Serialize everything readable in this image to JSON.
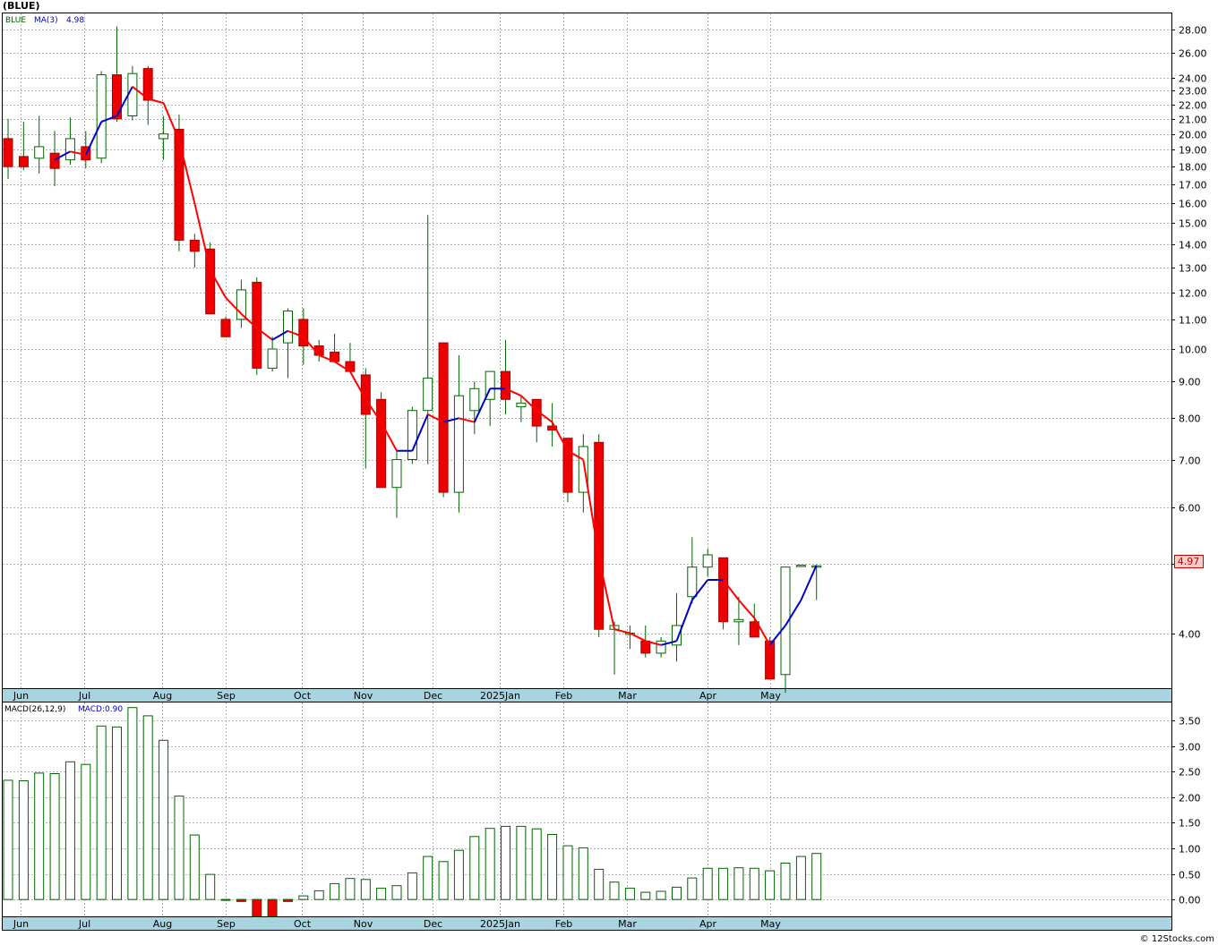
{
  "header": {
    "ticker_title": "(BLUE)",
    "legend_symbol": "BLUE",
    "legend_ma": "MA(3)",
    "legend_ma_value": "4.98",
    "macd_label": "MACD(26,12,9)",
    "macd_value": "MACD:0.90",
    "last_price_tag": "4.97",
    "watermark": "© 12Stocks.com"
  },
  "colors": {
    "up_candle": "#ffffff",
    "down_candle": "#ee0000",
    "candle_outline": "#006400",
    "ma_up": "#0000cc",
    "ma_down": "#ff0000",
    "date_band": "#a8d4e0",
    "grid": "#b4b4b4",
    "price_tag_bg": "#ffcccc"
  },
  "chart_data": [
    {
      "type": "candlestick",
      "scale": "log",
      "ylim": [
        3.35,
        29.5
      ],
      "y_ticks": [
        "4.00",
        "5.00",
        "6.00",
        "7.00",
        "8.00",
        "9.00",
        "10.00",
        "11.00",
        "12.00",
        "13.00",
        "14.00",
        "15.00",
        "16.00",
        "17.00",
        "18.00",
        "19.00",
        "20.00",
        "21.00",
        "22.00",
        "23.00",
        "24.00",
        "26.00",
        "28.00"
      ],
      "x_ticks": [
        {
          "label": "Jun",
          "index": 0.8
        },
        {
          "label": "Jul",
          "index": 4.9
        },
        {
          "label": "Aug",
          "index": 9.9
        },
        {
          "label": "Sep",
          "index": 14.0
        },
        {
          "label": "Oct",
          "index": 18.9
        },
        {
          "label": "Nov",
          "index": 22.8
        },
        {
          "label": "Dec",
          "index": 27.3
        },
        {
          "label": "2025Jan",
          "index": 31.6
        },
        {
          "label": "Feb",
          "index": 35.7
        },
        {
          "label": "Mar",
          "index": 39.8
        },
        {
          "label": "Apr",
          "index": 45.0
        },
        {
          "label": "May",
          "index": 49.0
        }
      ],
      "candles": [
        {
          "o": 19.7,
          "h": 21.0,
          "l": 17.3,
          "c": 18.0
        },
        {
          "o": 18.6,
          "h": 20.8,
          "l": 17.8,
          "c": 18.0
        },
        {
          "o": 18.5,
          "h": 21.2,
          "l": 17.6,
          "c": 19.2
        },
        {
          "o": 18.8,
          "h": 20.2,
          "l": 16.9,
          "c": 17.9
        },
        {
          "o": 18.4,
          "h": 21.1,
          "l": 18.1,
          "c": 19.7
        },
        {
          "o": 19.2,
          "h": 20.2,
          "l": 17.9,
          "c": 18.4
        },
        {
          "o": 18.5,
          "h": 24.5,
          "l": 18.2,
          "c": 24.2
        },
        {
          "o": 24.2,
          "h": 28.3,
          "l": 20.8,
          "c": 21.0
        },
        {
          "o": 21.2,
          "h": 24.9,
          "l": 20.9,
          "c": 24.3
        },
        {
          "o": 24.7,
          "h": 24.9,
          "l": 20.6,
          "c": 22.3
        },
        {
          "o": 19.7,
          "h": 21.2,
          "l": 18.4,
          "c": 20.0
        },
        {
          "o": 20.3,
          "h": 21.3,
          "l": 13.7,
          "c": 14.2
        },
        {
          "o": 14.2,
          "h": 14.5,
          "l": 13.0,
          "c": 13.7
        },
        {
          "o": 13.8,
          "h": 14.1,
          "l": 11.2,
          "c": 11.2
        },
        {
          "o": 11.0,
          "h": 11.1,
          "l": 10.4,
          "c": 10.4
        },
        {
          "o": 11.0,
          "h": 12.5,
          "l": 10.7,
          "c": 12.1
        },
        {
          "o": 12.4,
          "h": 12.6,
          "l": 9.2,
          "c": 9.4
        },
        {
          "o": 9.4,
          "h": 10.4,
          "l": 9.3,
          "c": 10.0
        },
        {
          "o": 10.2,
          "h": 11.4,
          "l": 9.1,
          "c": 11.3
        },
        {
          "o": 11.0,
          "h": 11.4,
          "l": 9.5,
          "c": 10.1
        },
        {
          "o": 10.1,
          "h": 10.3,
          "l": 9.6,
          "c": 9.8
        },
        {
          "o": 9.9,
          "h": 10.5,
          "l": 9.6,
          "c": 9.6
        },
        {
          "o": 9.6,
          "h": 10.2,
          "l": 9.3,
          "c": 9.3
        },
        {
          "o": 9.2,
          "h": 9.4,
          "l": 6.8,
          "c": 8.1
        },
        {
          "o": 8.5,
          "h": 8.7,
          "l": 6.4,
          "c": 6.4
        },
        {
          "o": 6.4,
          "h": 7.2,
          "l": 5.8,
          "c": 7.0
        },
        {
          "o": 7.0,
          "h": 8.3,
          "l": 6.9,
          "c": 8.2
        },
        {
          "o": 8.2,
          "h": 15.4,
          "l": 6.9,
          "c": 9.1
        },
        {
          "o": 10.2,
          "h": 10.2,
          "l": 6.2,
          "c": 6.3
        },
        {
          "o": 6.3,
          "h": 9.8,
          "l": 5.9,
          "c": 8.6
        },
        {
          "o": 8.2,
          "h": 9.0,
          "l": 7.6,
          "c": 8.8
        },
        {
          "o": 8.5,
          "h": 9.3,
          "l": 7.8,
          "c": 9.3
        },
        {
          "o": 9.3,
          "h": 10.3,
          "l": 8.1,
          "c": 8.5
        },
        {
          "o": 8.3,
          "h": 8.6,
          "l": 7.9,
          "c": 8.4
        },
        {
          "o": 8.5,
          "h": 8.5,
          "l": 7.4,
          "c": 7.8
        },
        {
          "o": 7.8,
          "h": 8.4,
          "l": 7.3,
          "c": 7.7
        },
        {
          "o": 7.5,
          "h": 7.5,
          "l": 6.1,
          "c": 6.3
        },
        {
          "o": 6.3,
          "h": 7.6,
          "l": 5.9,
          "c": 7.3
        },
        {
          "o": 7.4,
          "h": 7.6,
          "l": 3.95,
          "c": 4.05
        },
        {
          "o": 4.05,
          "h": 4.15,
          "l": 3.5,
          "c": 4.1
        },
        {
          "o": 4.0,
          "h": 4.1,
          "l": 3.8,
          "c": 4.0
        },
        {
          "o": 3.9,
          "h": 4.1,
          "l": 3.7,
          "c": 3.75
        },
        {
          "o": 3.75,
          "h": 3.95,
          "l": 3.7,
          "c": 3.9
        },
        {
          "o": 3.85,
          "h": 4.55,
          "l": 3.65,
          "c": 4.1
        },
        {
          "o": 4.5,
          "h": 5.45,
          "l": 4.4,
          "c": 4.95
        },
        {
          "o": 4.95,
          "h": 5.25,
          "l": 4.8,
          "c": 5.15
        },
        {
          "o": 5.1,
          "h": 5.1,
          "l": 4.05,
          "c": 4.15
        },
        {
          "o": 4.15,
          "h": 4.5,
          "l": 3.85,
          "c": 4.18
        },
        {
          "o": 4.15,
          "h": 4.4,
          "l": 3.95,
          "c": 3.95
        },
        {
          "o": 3.9,
          "h": 3.95,
          "l": 3.45,
          "c": 3.45
        },
        {
          "o": 3.5,
          "h": 4.95,
          "l": 3.3,
          "c": 4.95
        },
        {
          "o": 4.97,
          "h": 4.98,
          "l": 4.96,
          "c": 4.98
        },
        {
          "o": 4.97,
          "h": 4.98,
          "l": 4.45,
          "c": 4.97
        }
      ],
      "ma3": [
        18.6,
        18.4,
        18.4,
        18.4,
        18.9,
        18.7,
        20.8,
        21.2,
        23.3,
        22.4,
        22.1,
        19.6,
        16.0,
        12.9,
        11.8,
        11.2,
        10.7,
        10.3,
        10.6,
        10.4,
        9.8,
        9.6,
        9.3,
        8.5,
        7.9,
        7.2,
        7.2,
        8.1,
        7.9,
        8.0,
        7.9,
        8.8,
        8.8,
        8.6,
        8.2,
        7.9,
        7.2,
        7.0,
        5.1,
        4.05,
        4.0,
        3.9,
        3.85,
        3.9,
        4.45,
        4.75,
        4.75,
        4.45,
        4.2,
        3.85,
        4.1,
        4.45,
        4.98
      ]
    },
    {
      "type": "bar",
      "ylim": [
        -0.33,
        3.85
      ],
      "y_ticks": [
        "0.00",
        "0.50",
        "1.00",
        "1.50",
        "2.00",
        "2.50",
        "3.00",
        "3.50"
      ],
      "series": [
        {
          "name": "MACD:0.90",
          "values": [
            2.33,
            2.32,
            2.47,
            2.46,
            2.69,
            2.64,
            3.39,
            3.37,
            3.75,
            3.59,
            3.11,
            2.02,
            1.26,
            0.49,
            0.0,
            -0.04,
            -0.33,
            -0.33,
            -0.04,
            0.07,
            0.17,
            0.31,
            0.41,
            0.39,
            0.22,
            0.27,
            0.52,
            0.84,
            0.74,
            0.96,
            1.23,
            1.39,
            1.43,
            1.43,
            1.38,
            1.27,
            1.05,
            1.01,
            0.59,
            0.34,
            0.22,
            0.14,
            0.16,
            0.24,
            0.42,
            0.61,
            0.61,
            0.62,
            0.61,
            0.56,
            0.71,
            0.84,
            0.9
          ]
        }
      ]
    }
  ]
}
